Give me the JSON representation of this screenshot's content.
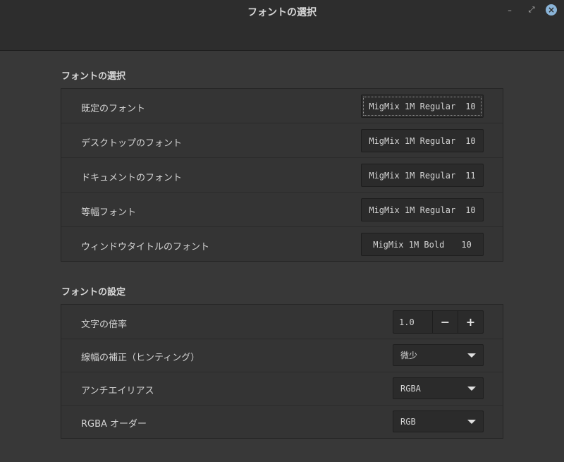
{
  "window": {
    "title": "フォントの選択",
    "minimize_glyph": "–",
    "maximize_glyph": "⤢",
    "close_glyph": "×"
  },
  "font_selection": {
    "heading": "フォントの選択",
    "rows": [
      {
        "label": "既定のフォント",
        "font": "MigMix 1M Regular",
        "size": "10"
      },
      {
        "label": "デスクトップのフォント",
        "font": "MigMix 1M Regular",
        "size": "10"
      },
      {
        "label": "ドキュメントのフォント",
        "font": "MigMix 1M Regular",
        "size": "11"
      },
      {
        "label": "等幅フォント",
        "font": "MigMix 1M Regular",
        "size": "10"
      },
      {
        "label": "ウィンドウタイトルのフォント",
        "font": "MigMix 1M Bold",
        "size": "10"
      }
    ]
  },
  "font_settings": {
    "heading": "フォントの設定",
    "scale": {
      "label": "文字の倍率",
      "value": "1.0",
      "minus": "−",
      "plus": "+"
    },
    "hinting": {
      "label": "線幅の補正（ヒンティング）",
      "value": "微少"
    },
    "antialias": {
      "label": "アンチエイリアス",
      "value": "RGBA"
    },
    "rgba_order": {
      "label": "RGBA オーダー",
      "value": "RGB"
    }
  }
}
